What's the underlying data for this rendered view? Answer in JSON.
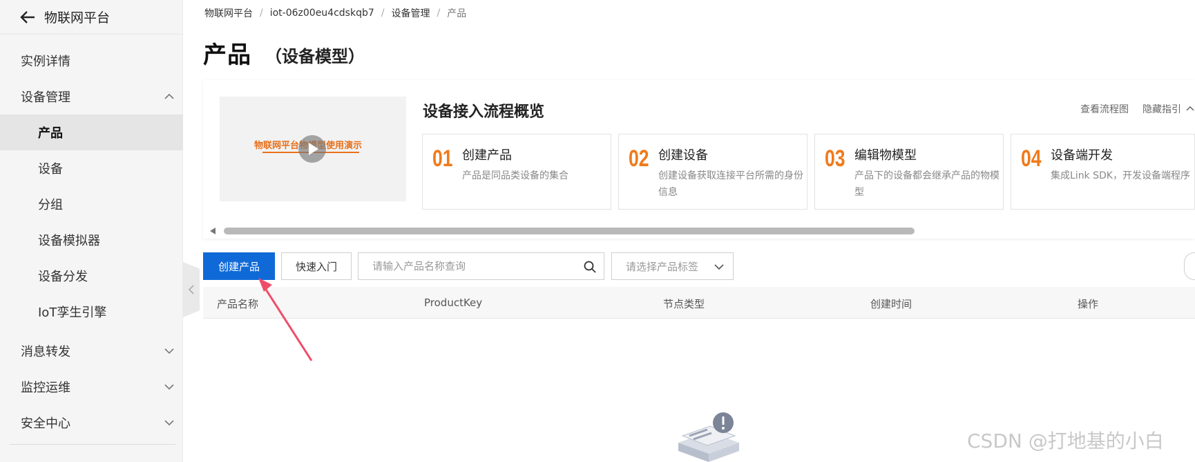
{
  "sidebar": {
    "title": "物联网平台",
    "items": [
      {
        "label": "实例详情"
      },
      {
        "label": "设备管理"
      },
      {
        "label": "产品"
      },
      {
        "label": "设备"
      },
      {
        "label": "分组"
      },
      {
        "label": "设备模拟器"
      },
      {
        "label": "设备分发"
      },
      {
        "label": "IoT孪生引擎"
      },
      {
        "label": "消息转发"
      },
      {
        "label": "监控运维"
      },
      {
        "label": "安全中心"
      }
    ]
  },
  "breadcrumb": [
    "物联网平台",
    "iot-06z00eu4cdskqb7",
    "设备管理",
    "产品"
  ],
  "page": {
    "title": "产品",
    "subtitle": "（设备模型）"
  },
  "guide": {
    "title": "设备接入流程概览",
    "video_text": "物联网平台物模型使用演示",
    "links": {
      "flowchart": "查看流程图",
      "hide": "隐藏指引"
    },
    "steps": [
      {
        "num": "01",
        "title": "创建产品",
        "desc": "产品是同品类设备的集合"
      },
      {
        "num": "02",
        "title": "创建设备",
        "desc": "创建设备获取连接平台所需的身份信息"
      },
      {
        "num": "03",
        "title": "编辑物模型",
        "desc": "产品下的设备都会继承产品的物模型"
      },
      {
        "num": "04",
        "title": "设备端开发",
        "desc": "集成Link SDK，开发设备端程序"
      }
    ]
  },
  "toolbar": {
    "create_label": "创建产品",
    "quickstart_label": "快速入门",
    "search_placeholder": "请输入产品名称查询",
    "tag_placeholder": "请选择产品标签"
  },
  "table": {
    "columns": [
      "产品名称",
      "ProductKey",
      "节点类型",
      "创建时间",
      "操作"
    ]
  },
  "watermark": "CSDN @打地基的小白",
  "colors": {
    "primary": "#0f6ad7",
    "step_number": "#f07a1a",
    "annotation_arrow": "#ee4d6a"
  }
}
